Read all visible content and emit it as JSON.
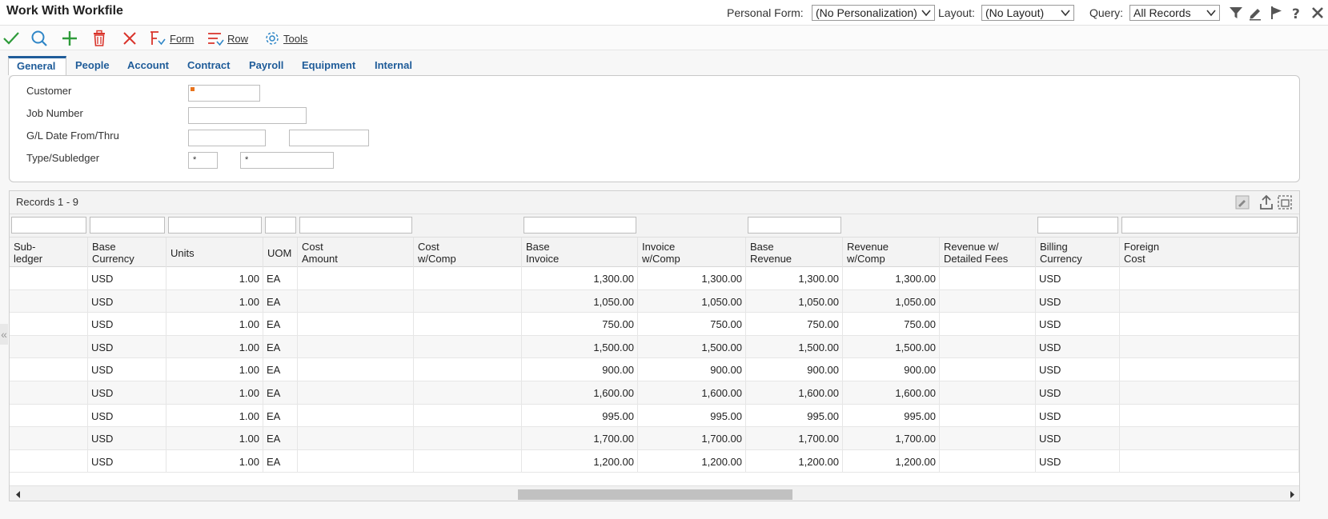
{
  "header": {
    "title": "Work With Workfile",
    "personal_form_label": "Personal Form:",
    "personal_form_value": "(No Personalization)",
    "layout_label": "Layout:",
    "layout_value": "(No Layout)",
    "query_label": "Query:",
    "query_value": "All Records"
  },
  "toolbar": {
    "form_label": "Form",
    "row_label": "Row",
    "tools_label": "Tools"
  },
  "tabs": [
    "General",
    "People",
    "Account",
    "Contract",
    "Payroll",
    "Equipment",
    "Internal"
  ],
  "criteria": {
    "customer_label": "Customer",
    "job_number_label": "Job Number",
    "gl_date_label": "G/L Date From/Thru",
    "type_subledger_label": "Type/Subledger",
    "type_value": "*",
    "subledger_value": "*"
  },
  "grid": {
    "records_label": "Records 1 - 9",
    "columns": [
      [
        "Sub-",
        "ledger"
      ],
      [
        "Base",
        "Currency"
      ],
      [
        "Units",
        ""
      ],
      [
        "UOM",
        ""
      ],
      [
        "Cost",
        "Amount"
      ],
      [
        "Cost",
        "w/Comp"
      ],
      [
        "Base",
        "Invoice"
      ],
      [
        "Invoice",
        "w/Comp"
      ],
      [
        "Base",
        "Revenue"
      ],
      [
        "Revenue",
        "w/Comp"
      ],
      [
        "Revenue w/",
        "Detailed Fees"
      ],
      [
        "Billing",
        "Currency"
      ],
      [
        "Foreign",
        "Cost"
      ]
    ],
    "rows": [
      [
        "",
        "USD",
        "1.00",
        "EA",
        "",
        "",
        "1,300.00",
        "1,300.00",
        "1,300.00",
        "1,300.00",
        "",
        "USD",
        ""
      ],
      [
        "",
        "USD",
        "1.00",
        "EA",
        "",
        "",
        "1,050.00",
        "1,050.00",
        "1,050.00",
        "1,050.00",
        "",
        "USD",
        ""
      ],
      [
        "",
        "USD",
        "1.00",
        "EA",
        "",
        "",
        "750.00",
        "750.00",
        "750.00",
        "750.00",
        "",
        "USD",
        ""
      ],
      [
        "",
        "USD",
        "1.00",
        "EA",
        "",
        "",
        "1,500.00",
        "1,500.00",
        "1,500.00",
        "1,500.00",
        "",
        "USD",
        ""
      ],
      [
        "",
        "USD",
        "1.00",
        "EA",
        "",
        "",
        "900.00",
        "900.00",
        "900.00",
        "900.00",
        "",
        "USD",
        ""
      ],
      [
        "",
        "USD",
        "1.00",
        "EA",
        "",
        "",
        "1,600.00",
        "1,600.00",
        "1,600.00",
        "1,600.00",
        "",
        "USD",
        ""
      ],
      [
        "",
        "USD",
        "1.00",
        "EA",
        "",
        "",
        "995.00",
        "995.00",
        "995.00",
        "995.00",
        "",
        "USD",
        ""
      ],
      [
        "",
        "USD",
        "1.00",
        "EA",
        "",
        "",
        "1,700.00",
        "1,700.00",
        "1,700.00",
        "1,700.00",
        "",
        "USD",
        ""
      ],
      [
        "",
        "USD",
        "1.00",
        "EA",
        "",
        "",
        "1,200.00",
        "1,200.00",
        "1,200.00",
        "1,200.00",
        "",
        "USD",
        ""
      ]
    ]
  },
  "colors": {
    "accent": "#1f5c99",
    "ok_green": "#2e9b3a",
    "search_blue": "#2f86c7",
    "delete_red": "#d9342b",
    "required_orange": "#e8731c"
  }
}
